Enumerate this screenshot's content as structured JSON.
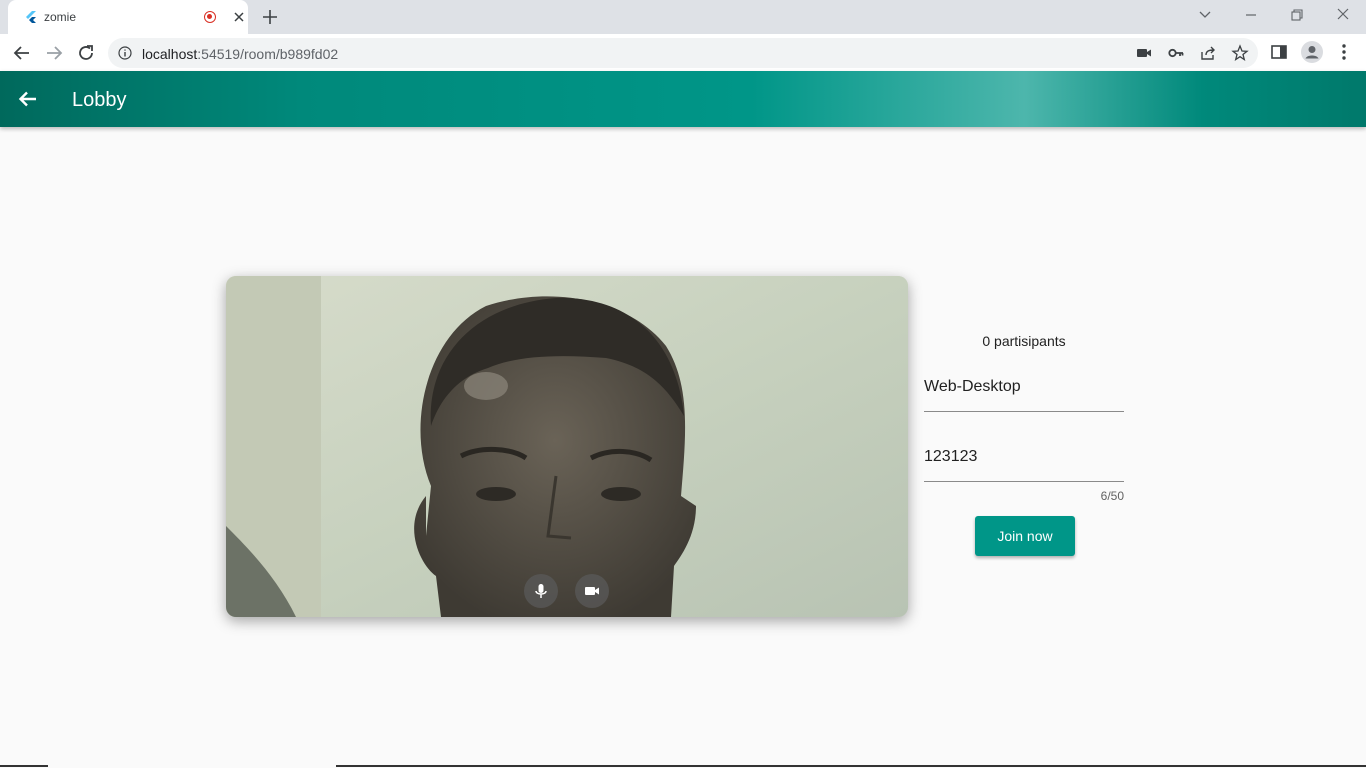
{
  "browser": {
    "tab_title": "zomie",
    "url_host": "localhost",
    "url_path": ":54519/room/b989fd02"
  },
  "appbar": {
    "title": "Lobby"
  },
  "lobby": {
    "participants": "0 partisipants",
    "name_value": "Web-Desktop",
    "code_value": "123123",
    "code_counter": "6/50",
    "join_label": "Join now"
  },
  "colors": {
    "primary": "#009688",
    "appbar_dark": "#00695c",
    "background": "#fafafa"
  },
  "icons": {
    "back": "arrow-left-icon",
    "mic": "microphone-icon",
    "camera": "videocam-icon"
  }
}
